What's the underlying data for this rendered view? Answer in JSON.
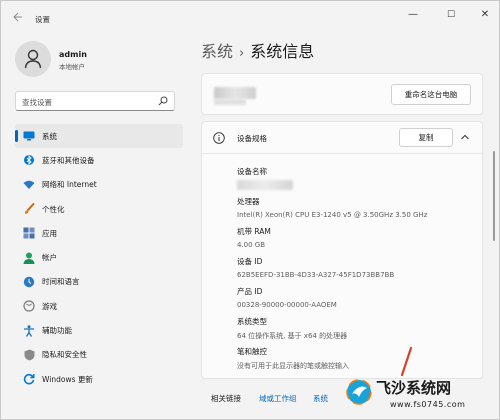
{
  "window": {
    "title": "设置",
    "controls": {
      "minimize": "—",
      "maximize": "☐",
      "close": "✕"
    }
  },
  "profile": {
    "name": "admin",
    "subtitle": "本地帐户"
  },
  "search": {
    "placeholder": "查找设置"
  },
  "nav": {
    "items": [
      {
        "label": "系统",
        "icon": "monitor-icon",
        "color": "#0078d4",
        "active": true
      },
      {
        "label": "蓝牙和其他设备",
        "icon": "bluetooth-icon",
        "color": "#0078d4"
      },
      {
        "label": "网络和 Internet",
        "icon": "wifi-icon",
        "color": "#2b78c5"
      },
      {
        "label": "个性化",
        "icon": "brush-icon",
        "color": "#e0851c"
      },
      {
        "label": "应用",
        "icon": "apps-icon",
        "color": "#4a6fa5"
      },
      {
        "label": "帐户",
        "icon": "person-icon",
        "color": "#1aa260"
      },
      {
        "label": "时间和语言",
        "icon": "globe-clock-icon",
        "color": "#2a7ac0"
      },
      {
        "label": "游戏",
        "icon": "gamepad-icon",
        "color": "#7a7a7a"
      },
      {
        "label": "辅助功能",
        "icon": "accessibility-icon",
        "color": "#1a73c7"
      },
      {
        "label": "隐私和安全性",
        "icon": "shield-icon",
        "color": "#6e6e6e"
      },
      {
        "label": "Windows 更新",
        "icon": "update-icon",
        "color": "#0078d4"
      }
    ]
  },
  "main": {
    "breadcrumb_root": "系统",
    "breadcrumb_sep": "›",
    "breadcrumb_page": "系统信息",
    "rename_button": "重命名这台电脑",
    "specs": {
      "title": "设备规格",
      "copy_button": "复制",
      "rows": [
        {
          "label": "设备名称",
          "value": ""
        },
        {
          "label": "处理器",
          "value": "Intel(R) Xeon(R) CPU E3-1240 v5 @ 3.50GHz   3.50 GHz"
        },
        {
          "label": "机带 RAM",
          "value": "4.00 GB"
        },
        {
          "label": "设备 ID",
          "value": "62B5EEFD-31BB-4D33-A327-45F1D73BB7BB"
        },
        {
          "label": "产品 ID",
          "value": "00328-90000-00000-AAOEM"
        },
        {
          "label": "系统类型",
          "value": "64 位操作系统, 基于 x64 的处理器"
        },
        {
          "label": "笔和触控",
          "value": "没有可用于此显示器的笔或触控输入"
        }
      ]
    },
    "related": {
      "label": "相关链接",
      "links": [
        "域或工作组",
        "系统"
      ]
    }
  },
  "watermark": {
    "title": "飞沙系统网",
    "url": "www.fs0745.com"
  },
  "colors": {
    "accent": "#0067c0",
    "background": "#f3f3f3",
    "card": "#fbfbfb"
  }
}
